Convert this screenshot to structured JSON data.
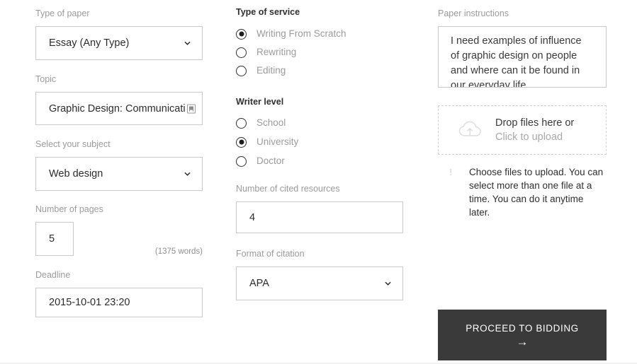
{
  "form": {
    "left_column": {
      "type_of_paper": {
        "label": "Type of paper",
        "value": "Essay (Any Type)",
        "icon": "chevron-down-icon"
      },
      "topic": {
        "label": "Topic",
        "value": "Graphic Design: Communicatin",
        "icon": "text-field-icon"
      },
      "subject": {
        "label": "Select your subject",
        "value": "Web design",
        "icon": "chevron-down-icon"
      },
      "pages": {
        "label": "Number of pages",
        "value": "5",
        "words_hint": "(1375 words)"
      },
      "deadline": {
        "label": "Deadline",
        "value": "2015-10-01 23:20"
      }
    },
    "middle_column": {
      "type_of_service": {
        "label": "Type of service",
        "options": [
          {
            "label": "Writing From Scratch",
            "selected": true
          },
          {
            "label": "Rewriting",
            "selected": false
          },
          {
            "label": "Editing",
            "selected": false
          }
        ]
      },
      "writer_level": {
        "label": "Writer level",
        "options": [
          {
            "label": "School",
            "selected": false
          },
          {
            "label": "University",
            "selected": true
          },
          {
            "label": "Doctor",
            "selected": false
          }
        ]
      },
      "cited_resources": {
        "label": "Number of cited resources",
        "value": "4"
      },
      "format_of_citation": {
        "label": "Format of citation",
        "value": "APA",
        "icon": "chevron-down-icon"
      }
    },
    "right_column": {
      "paper_instructions": {
        "label": "Paper instructions",
        "value": "I need examples of influence of graphic design on people and where can it be found in our everyday life."
      },
      "upload": {
        "icon": "cloud-upload-icon",
        "line1": "Drop files here or",
        "line2": "Click to upload"
      },
      "upload_note": {
        "icon": "info-icon",
        "text": "Choose files to upload. You can select more than one file at a time. You can do it anytime later."
      },
      "proceed_button": {
        "label": "PROCEED TO BIDDING",
        "arrow": "→"
      }
    }
  },
  "colors": {
    "label_gray": "#9b9b9b",
    "text_dark": "#2b2b2b",
    "border": "#c9c9c9",
    "button_bg": "#3a3a3a",
    "button_text": "#ffffff"
  }
}
